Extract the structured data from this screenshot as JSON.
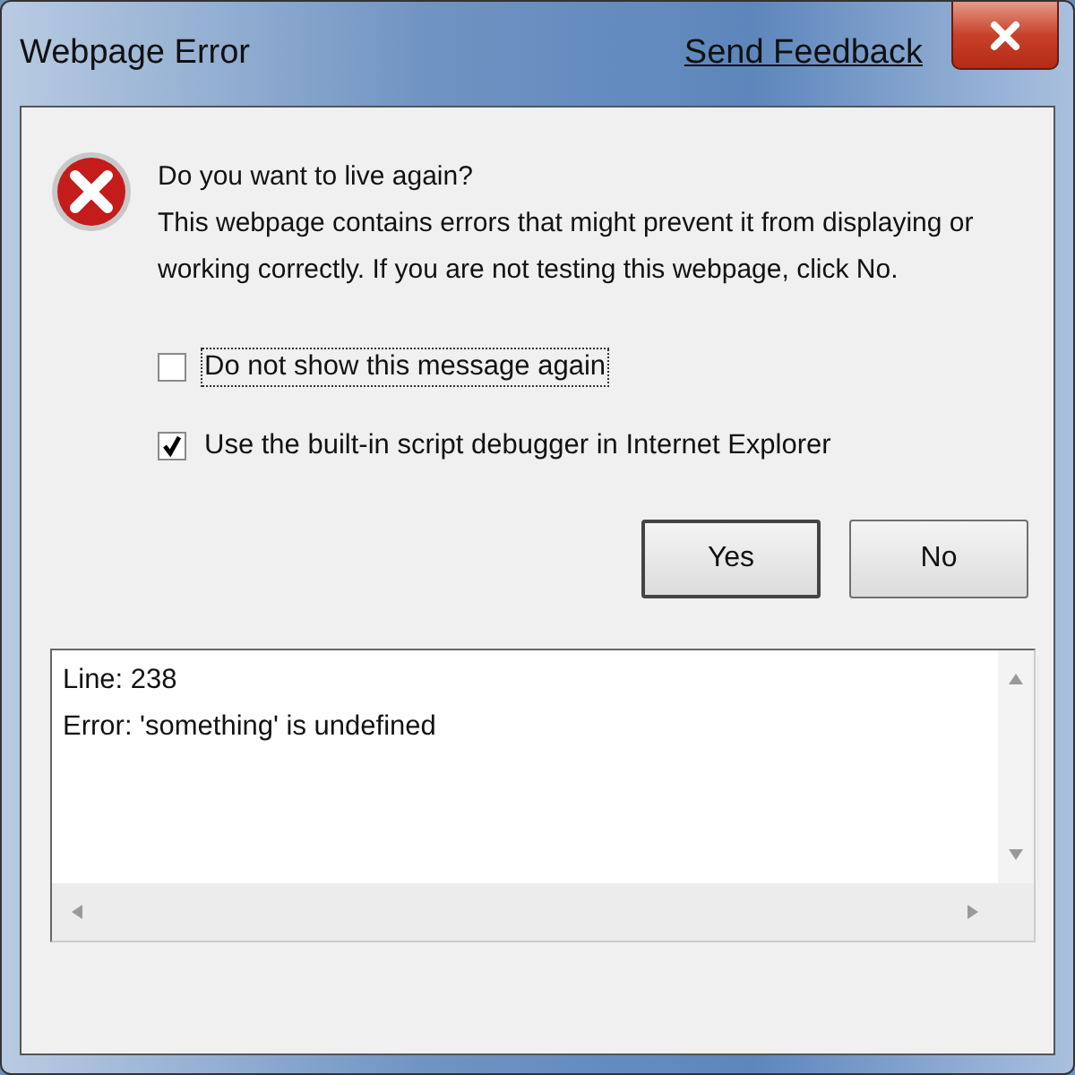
{
  "window": {
    "title": "Webpage Error",
    "feedback_link": "Send Feedback"
  },
  "message": {
    "question": "Do you want to live again?",
    "text": "This webpage contains errors that might prevent it from displaying or working correctly. If you are not testing this webpage, click No."
  },
  "options": [
    {
      "label": "Do not show this message again",
      "checked": false,
      "focused": true
    },
    {
      "label": "Use the built-in script debugger in Internet Explorer",
      "checked": true,
      "focused": false
    }
  ],
  "buttons": [
    {
      "label": "Yes",
      "default": true
    },
    {
      "label": "No",
      "default": false
    }
  ],
  "details": {
    "lines": [
      "Line: 238",
      "Error: 'something' is undefined"
    ]
  }
}
